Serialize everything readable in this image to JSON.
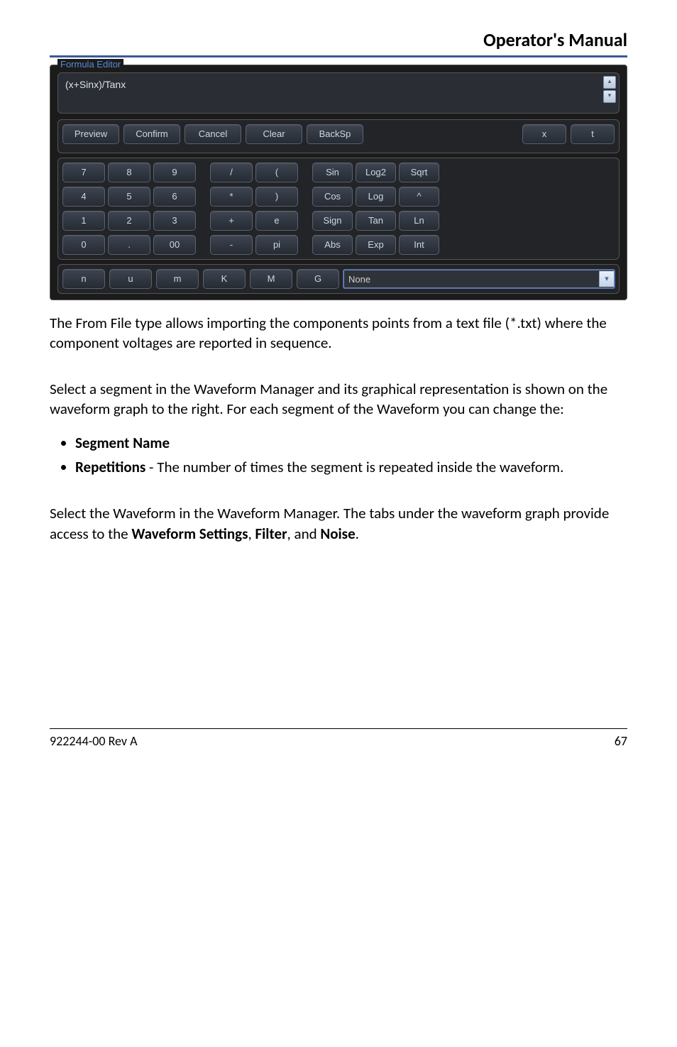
{
  "header": {
    "title": "Operator's Manual"
  },
  "editor": {
    "legend": "Formula Editor",
    "formula_value": "(x+Sinx)/Tanx",
    "scroll_up": "▴",
    "scroll_down": "▾",
    "actions": {
      "preview": "Preview",
      "confirm": "Confirm",
      "cancel": "Cancel",
      "clear": "Clear",
      "backsp": "BackSp",
      "x": "x",
      "t": "t"
    },
    "numpad": [
      [
        "7",
        "8",
        "9"
      ],
      [
        "4",
        "5",
        "6"
      ],
      [
        "1",
        "2",
        "3"
      ],
      [
        "0",
        ".",
        "00"
      ]
    ],
    "oppad": [
      [
        "/",
        "("
      ],
      [
        "*",
        ")"
      ],
      [
        "+",
        "e"
      ],
      [
        "-",
        "pi"
      ]
    ],
    "funcpad": [
      [
        "Sin",
        "Log2",
        "Sqrt"
      ],
      [
        "Cos",
        "Log",
        "^"
      ],
      [
        "Sign",
        "Tan",
        "Ln"
      ],
      [
        "Abs",
        "Exp",
        "Int"
      ]
    ],
    "bottom_row": [
      "n",
      "u",
      "m",
      "K",
      "M",
      "G"
    ],
    "dropdown": {
      "selected": "None",
      "arrow": "▾"
    }
  },
  "body": {
    "p1": "The From File type allows importing the components points from a text file (*.txt) where the component voltages are reported in sequence.",
    "p2": "Select a segment in the Waveform Manager and its graphical representation is shown on the waveform graph to the right. For each segment of the Waveform you can change the:",
    "bullets": [
      {
        "bold": "Segment Name",
        "rest": ""
      },
      {
        "bold": "Repetitions",
        "rest": " - The number of times the segment is repeated inside the waveform."
      }
    ],
    "p3_pre": "Select the Waveform in the Waveform Manager. The tabs under the waveform graph provide access to the ",
    "p3_b1": "Waveform Settings",
    "p3_mid1": ", ",
    "p3_b2": "Filter",
    "p3_mid2": ", and ",
    "p3_b3": "Noise",
    "p3_end": "."
  },
  "footer": {
    "left": "922244-00 Rev A",
    "right": "67"
  }
}
